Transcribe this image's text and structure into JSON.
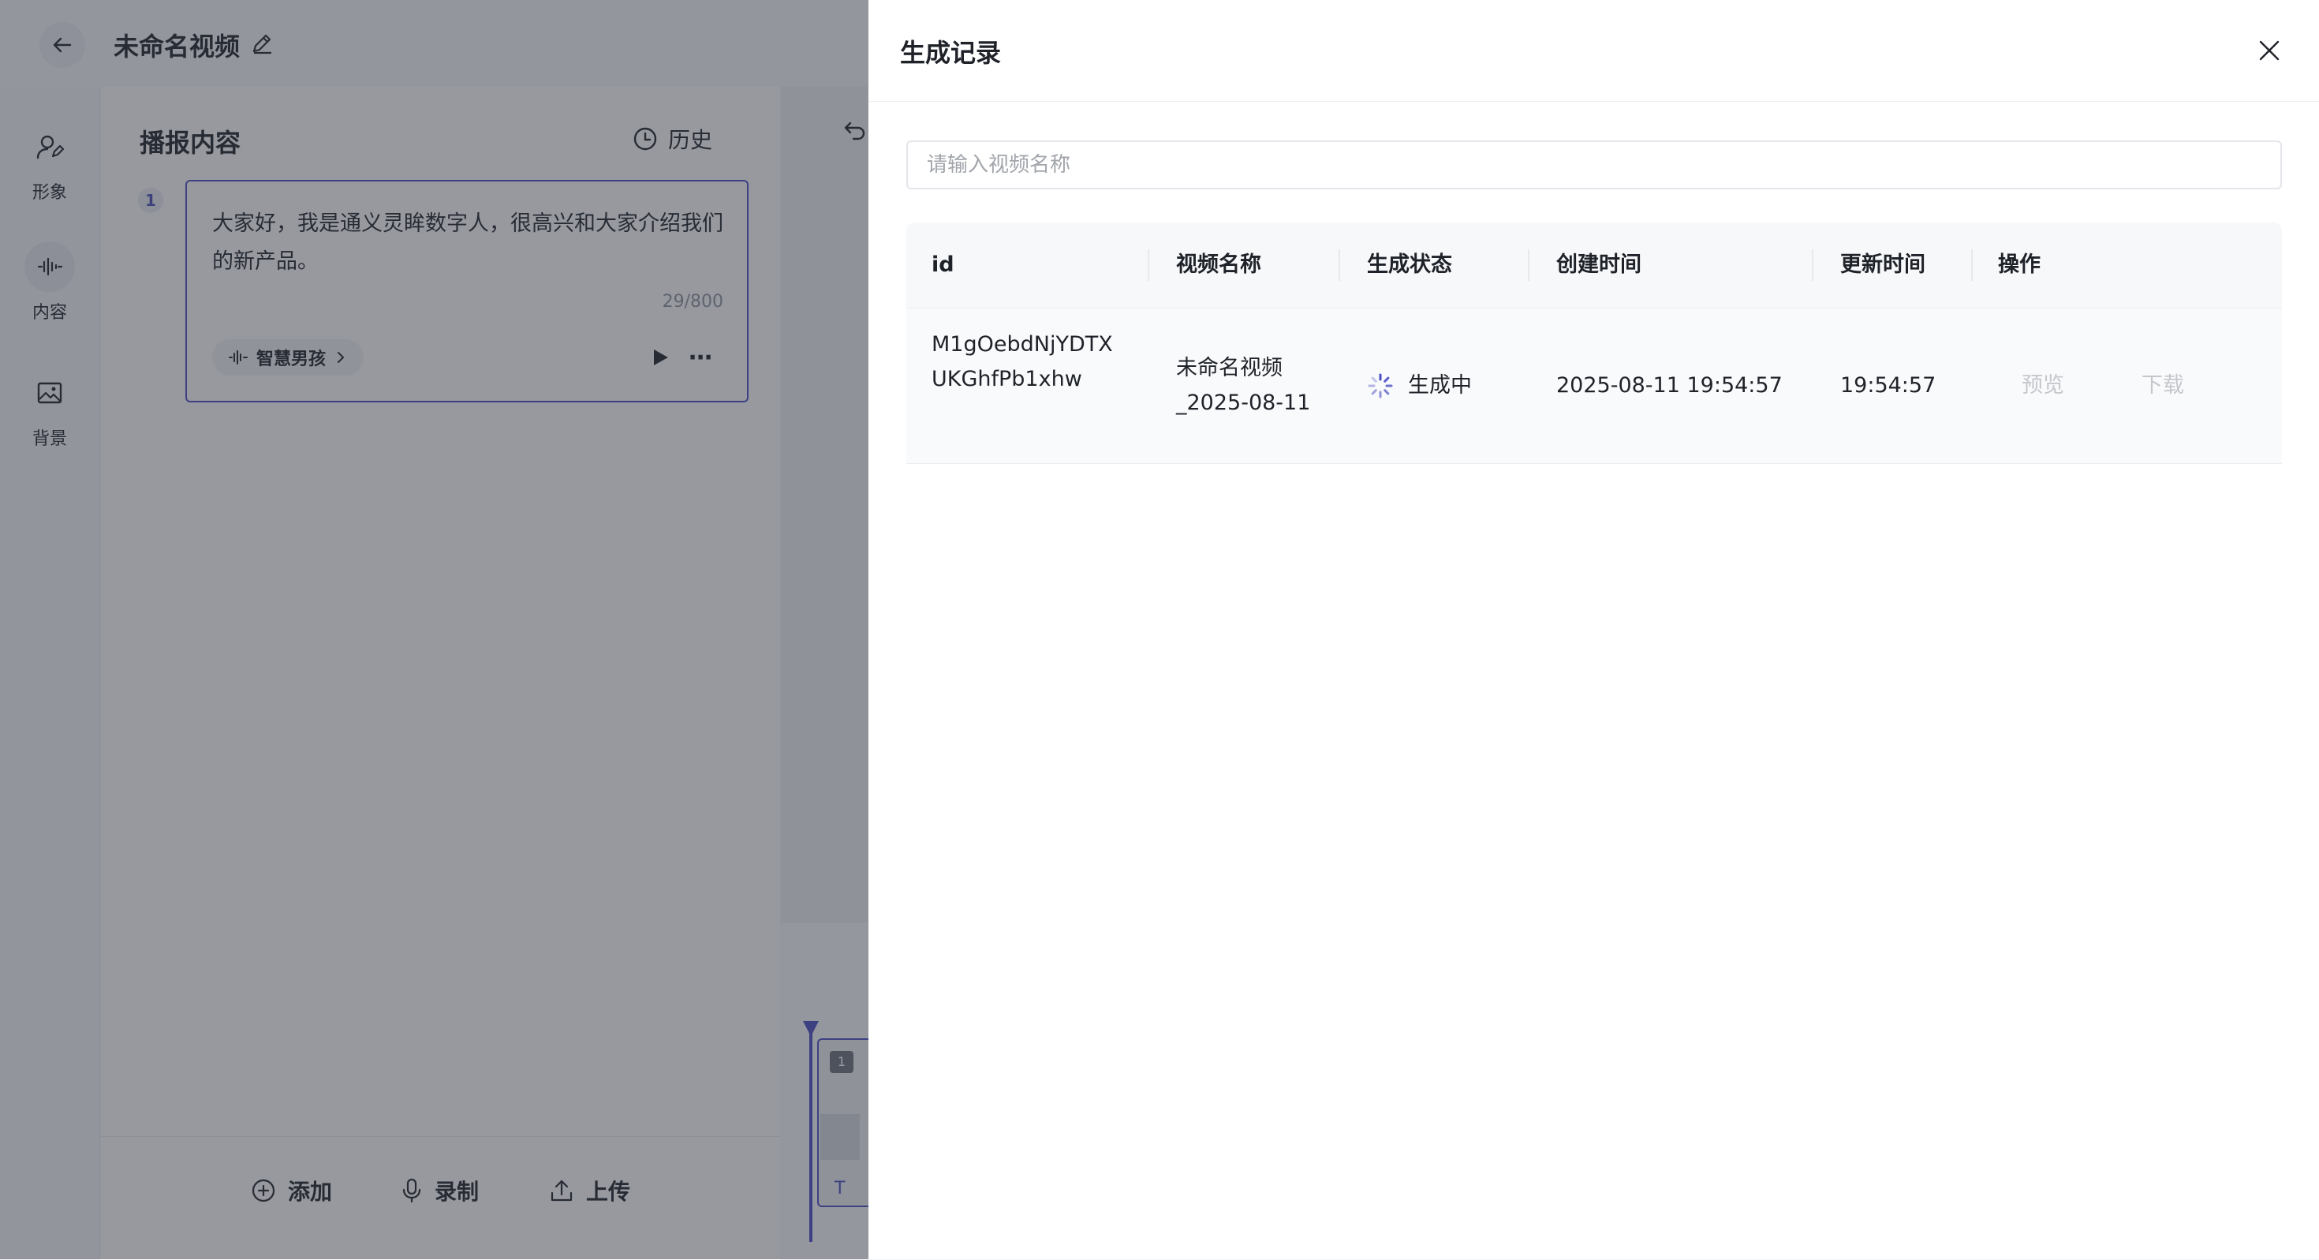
{
  "app": {
    "video_title": "未命名视频",
    "nav": [
      {
        "label": "形象",
        "icon": "avatar-icon"
      },
      {
        "label": "内容",
        "icon": "waveform-icon"
      },
      {
        "label": "背景",
        "icon": "image-icon"
      }
    ],
    "panel_title": "播报内容",
    "history_label": "历史",
    "segment": {
      "number": "1",
      "text": "大家好，我是通义灵眸数字人，很高兴和大家介绍我们的新产品。",
      "count": "29/800",
      "voice": "智慧男孩"
    },
    "actions": {
      "add": "添加",
      "record": "录制",
      "upload": "上传"
    },
    "timeline": {
      "clip_number": "1",
      "clip_text": "T"
    }
  },
  "drawer": {
    "title": "生成记录",
    "search": {
      "placeholder": "请输入视频名称",
      "value": ""
    },
    "columns": [
      "id",
      "视频名称",
      "生成状态",
      "创建时间",
      "更新时间",
      "操作"
    ],
    "rows": [
      {
        "id": "M1gOebdNjYDTXUKGhfPb1xhw",
        "name": "未命名视频_2025-08-11",
        "status": "生成中",
        "created": "2025-08-11 19:54:57",
        "updated": "19:54:57",
        "preview_label": "预览",
        "download_label": "下载"
      }
    ]
  },
  "colors": {
    "accent": "#4a4fc4",
    "mask": "#303440",
    "disabled": "#c4c7cc"
  }
}
